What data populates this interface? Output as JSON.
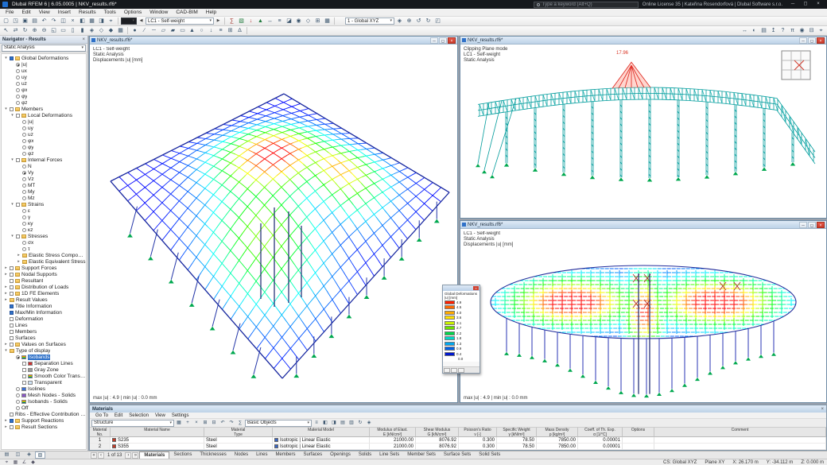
{
  "title_bar": {
    "app_title": "Dlubal RFEM 6 | 6.05.0005 | NKV_results.rf6*",
    "search_placeholder": "Type a keyword (Alt+Q)",
    "license_info": "Online License 35 | Kateřina Rosendorfová | Dlubal Software s.r.o.",
    "window_buttons": {
      "minimize": "─",
      "maximize": "◻",
      "close": "×"
    }
  },
  "menu_bar": {
    "items": [
      "File",
      "Edit",
      "View",
      "Insert",
      "Results",
      "Tools",
      "Options",
      "Window",
      "CAD-BIM",
      "Help"
    ]
  },
  "glyphs": {
    "caret": "▾",
    "prev": "◀",
    "next": "▶"
  },
  "toolbar1": {
    "group_a": [
      {
        "n": "new-model-icon",
        "g": "▢"
      },
      {
        "n": "open-model-icon",
        "g": "◳"
      },
      {
        "n": "save-icon",
        "g": "▣"
      },
      {
        "n": "print-icon",
        "g": "▤"
      },
      {
        "n": "undo-icon",
        "g": "↶"
      },
      {
        "n": "redo-icon",
        "g": "↷"
      },
      {
        "n": "copy-icon",
        "g": "◫"
      },
      {
        "n": "delete-icon",
        "g": "×"
      },
      {
        "n": "navigator-toggle-icon",
        "g": "◧"
      },
      {
        "n": "tables-toggle-icon",
        "g": "▦"
      },
      {
        "n": "panel-toggle-icon",
        "g": "◨"
      },
      {
        "n": "snap-settings-icon",
        "g": "⌖"
      }
    ],
    "render_combo_glyph": "▾",
    "load_case": "LC1 - Self-weight",
    "group_b": [
      {
        "n": "calculate-icon",
        "g": "∑",
        "c": "#a03028"
      },
      {
        "n": "show-results-icon",
        "g": "▧",
        "c": "#1f7a3c"
      },
      {
        "n": "show-loads-icon",
        "g": "↓",
        "c": "#b03030"
      },
      {
        "n": "show-supports-icon",
        "g": "▲",
        "c": "#1f7a3c"
      },
      {
        "n": "show-dimensions-icon",
        "g": "↔"
      },
      {
        "n": "show-numbering-icon",
        "g": "≡"
      },
      {
        "n": "clipping-plane-icon",
        "g": "◪"
      },
      {
        "n": "visibility-icon",
        "g": "◉"
      },
      {
        "n": "selection-mode-icon",
        "g": "◇"
      },
      {
        "n": "generate-mesh-icon",
        "g": "⊞"
      },
      {
        "n": "fe-mesh-icon",
        "g": "▦"
      }
    ],
    "cs_combo": "1 - Global XYZ",
    "group_c": [
      {
        "n": "isometric-view-icon",
        "g": "◈"
      },
      {
        "n": "zoom-all-icon",
        "g": "⊕"
      },
      {
        "n": "previous-view-icon",
        "g": "↺"
      },
      {
        "n": "next-view-icon",
        "g": "↻"
      },
      {
        "n": "full-screen-icon",
        "g": "◰"
      }
    ]
  },
  "toolbar2": {
    "group_a": [
      {
        "n": "select-icon",
        "g": "↖"
      },
      {
        "n": "pan-icon",
        "g": "⇄"
      },
      {
        "n": "orbit-icon",
        "g": "↻"
      },
      {
        "n": "zoom-in-icon",
        "g": "⊕"
      },
      {
        "n": "zoom-out-icon",
        "g": "⊖"
      },
      {
        "n": "zoom-window-icon",
        "g": "◱"
      },
      {
        "n": "view-x-icon",
        "g": "▭"
      },
      {
        "n": "view-y-icon",
        "g": "▯"
      },
      {
        "n": "view-z-icon",
        "g": "▮"
      },
      {
        "n": "view-iso-icon",
        "g": "◈"
      },
      {
        "n": "wireframe-icon",
        "g": "◇"
      },
      {
        "n": "solid-display-icon",
        "g": "◆"
      },
      {
        "n": "mesh-display-icon",
        "g": "▦"
      }
    ],
    "group_b": [
      {
        "n": "new-node-icon",
        "g": "●"
      },
      {
        "n": "new-line-icon",
        "g": "∕"
      },
      {
        "n": "new-member-icon",
        "g": "─"
      },
      {
        "n": "new-surface-icon",
        "g": "▱"
      },
      {
        "n": "new-solid-icon",
        "g": "▰"
      },
      {
        "n": "new-opening-icon",
        "g": "▭"
      },
      {
        "n": "new-support-icon",
        "g": "▲"
      },
      {
        "n": "new-hinge-icon",
        "g": "○"
      },
      {
        "n": "new-load-icon",
        "g": "↓"
      },
      {
        "n": "load-cases-icon",
        "g": "≡"
      },
      {
        "n": "combinations-icon",
        "g": "⊞"
      },
      {
        "n": "imperfection-icon",
        "g": "∆"
      }
    ],
    "group_c": [
      {
        "n": "dimension-icon",
        "g": "↔"
      },
      {
        "n": "render-mode-icon",
        "g": "◐"
      },
      {
        "n": "print-graphic-icon",
        "g": "▤"
      },
      {
        "n": "export-icon",
        "g": "↥"
      },
      {
        "n": "help-icon",
        "g": "?"
      },
      {
        "n": "units-icon",
        "g": "π"
      },
      {
        "n": "info-icon",
        "g": "◉"
      },
      {
        "n": "collapse-icon",
        "g": "⊟"
      },
      {
        "n": "measure-icon",
        "g": "⌖"
      }
    ]
  },
  "navigator": {
    "title": "Navigator - Results",
    "close_glyph": "×",
    "analysis_combo": "Static Analysis",
    "tree": [
      {
        "l": "Global Deformations",
        "v": 0,
        "e": 1,
        "c": 1,
        "f": 1
      },
      {
        "l": "|u|",
        "v": 1,
        "r": 1
      },
      {
        "l": "ux",
        "v": 1,
        "r": 0
      },
      {
        "l": "uy",
        "v": 1,
        "r": 0
      },
      {
        "l": "uz",
        "v": 1,
        "r": 0
      },
      {
        "l": "φx",
        "v": 1,
        "r": 0
      },
      {
        "l": "φy",
        "v": 1,
        "r": 0
      },
      {
        "l": "φz",
        "v": 1,
        "r": 0
      },
      {
        "l": "Members",
        "v": 0,
        "e": 1,
        "c": 0,
        "f": 1
      },
      {
        "l": "Local Deformations",
        "v": 1,
        "e": 1,
        "c": 0,
        "f": 1
      },
      {
        "l": "|u|",
        "v": 2,
        "r": 0
      },
      {
        "l": "uy",
        "v": 2,
        "r": 0
      },
      {
        "l": "uz",
        "v": 2,
        "r": 0
      },
      {
        "l": "φx",
        "v": 2,
        "r": 0
      },
      {
        "l": "φy",
        "v": 2,
        "r": 0
      },
      {
        "l": "φz",
        "v": 2,
        "r": 0
      },
      {
        "l": "Internal Forces",
        "v": 1,
        "e": 1,
        "c": 0,
        "f": 1
      },
      {
        "l": "N",
        "v": 2,
        "r": 0
      },
      {
        "l": "Vy",
        "v": 2,
        "r": 1
      },
      {
        "l": "Vz",
        "v": 2,
        "r": 0
      },
      {
        "l": "MT",
        "v": 2,
        "r": 0
      },
      {
        "l": "My",
        "v": 2,
        "r": 0
      },
      {
        "l": "Mz",
        "v": 2,
        "r": 0
      },
      {
        "l": "Strains",
        "v": 1,
        "e": 1,
        "c": 0,
        "f": 1
      },
      {
        "l": "ε",
        "v": 2,
        "r": 0
      },
      {
        "l": "γ",
        "v": 2,
        "r": 0
      },
      {
        "l": "κy",
        "v": 2,
        "r": 0
      },
      {
        "l": "κz",
        "v": 2,
        "r": 0
      },
      {
        "l": "Stresses",
        "v": 1,
        "e": 1,
        "c": 0,
        "f": 1
      },
      {
        "l": "σx",
        "v": 2,
        "r": 0
      },
      {
        "l": "τ",
        "v": 2,
        "r": 0
      },
      {
        "l": "Elastic Stress Components",
        "v": 2,
        "e": 2,
        "f": 1
      },
      {
        "l": "Elastic Equivalent Stress",
        "v": 2,
        "e": 2,
        "f": 1
      },
      {
        "l": "Support Forces",
        "v": 0,
        "e": 2,
        "c": 0,
        "f": 1
      },
      {
        "l": "Nodal Supports",
        "v": 0,
        "e": 2,
        "c": 0,
        "f": 1
      },
      {
        "l": "Resultant",
        "v": 0,
        "c": 0,
        "f": 1
      },
      {
        "l": "Distribution of Loads",
        "v": 0,
        "e": 2,
        "c": 0,
        "f": 1
      },
      {
        "l": "1D FE Elements",
        "v": 0,
        "e": 2,
        "c": 0,
        "f": 1
      },
      {
        "l": "Result Values",
        "v": 0,
        "e": 2,
        "f": 1
      },
      {
        "l": "Title Information",
        "v": 0,
        "c": 1
      },
      {
        "l": "Max/Min Information",
        "v": 0,
        "c": 1
      },
      {
        "l": "Deformation",
        "v": 0,
        "c": 0
      },
      {
        "l": "Lines",
        "v": 0,
        "c": 0
      },
      {
        "l": "Members",
        "v": 0,
        "c": 0
      },
      {
        "l": "Surfaces",
        "v": 0,
        "c": 0
      },
      {
        "l": "Values on Surfaces",
        "v": 0,
        "e": 2,
        "c": 0,
        "f": 1
      },
      {
        "l": "Type of display",
        "v": 0,
        "e": 1,
        "f": 1
      },
      {
        "l": "Isobands",
        "v": 1,
        "r": 1,
        "k": "rainbow",
        "h": 1
      },
      {
        "l": "Separation Lines",
        "v": 2,
        "c": 0,
        "k": "#cc3333"
      },
      {
        "l": "Gray Zone",
        "v": 2,
        "c": 0,
        "k": "#9a9a9a"
      },
      {
        "l": "Smooth Color Transition",
        "v": 2,
        "c": 0,
        "k": "rainbow"
      },
      {
        "l": "Transparent",
        "v": 2,
        "c": 0,
        "k": "#cfe3f5"
      },
      {
        "l": "Isolines",
        "v": 1,
        "r": 0,
        "k": "#3b6fd4"
      },
      {
        "l": "Mesh Nodes - Solids",
        "v": 1,
        "r": 0,
        "k": "#8a55c8"
      },
      {
        "l": "Isobands - Solids",
        "v": 1,
        "r": 0,
        "k": "rainbow"
      },
      {
        "l": "Off",
        "v": 1,
        "r": 0
      },
      {
        "l": "Ribs - Effective Contribution on Surfac...",
        "v": 0,
        "c": 0
      },
      {
        "l": "Support Reactions",
        "v": 0,
        "e": 2,
        "c": 1,
        "f": 1
      },
      {
        "l": "Result Sections",
        "v": 0,
        "e": 2,
        "c": 0,
        "f": 1
      }
    ],
    "bottom_tabs": [
      {
        "n": "data-navigator-tab-icon",
        "g": "▤"
      },
      {
        "n": "display-navigator-tab-icon",
        "g": "◫"
      },
      {
        "n": "views-navigator-tab-icon",
        "g": "◈"
      },
      {
        "n": "results-navigator-tab-icon",
        "g": "▧",
        "active": true
      }
    ]
  },
  "viewports": {
    "main": {
      "title": "NKV_results.rf6*",
      "info": [
        "LC1 - Self-weight",
        "Static Analysis",
        "Displacements |u| [mm]"
      ],
      "result_summary": "max |u| : 4.9 | min |u| : 0.0 mm"
    },
    "top_right": {
      "title": "NKV_results.rf6*",
      "info": [
        "Clipping Plane mode",
        "LC1 - Self-weight",
        "Static Analysis"
      ],
      "peak_value": "17.96"
    },
    "bottom_right": {
      "title": "NKV_results.rf6*",
      "info": [
        "LC1 - Self-weight",
        "Static Analysis",
        "Displacements |u| [mm]"
      ],
      "result_summary": "max |u| : 4.9 | min |u| : 0.0 mm"
    }
  },
  "legend": {
    "title": "Global Deformations",
    "subtitle": "|u| [mm]",
    "bands": [
      {
        "color": "#ff2000",
        "value": "4.9"
      },
      {
        "color": "#ff6a00",
        "value": "4.5"
      },
      {
        "color": "#ffaa00",
        "value": "4.0"
      },
      {
        "color": "#ffe000",
        "value": "3.6"
      },
      {
        "color": "#c8f000",
        "value": "3.1"
      },
      {
        "color": "#6ee000",
        "value": "2.7"
      },
      {
        "color": "#00d84a",
        "value": "2.2"
      },
      {
        "color": "#00d8c8",
        "value": "1.8"
      },
      {
        "color": "#00a8f0",
        "value": "1.3"
      },
      {
        "color": "#0060e8",
        "value": "0.9"
      },
      {
        "color": "#0018d0",
        "value": "0.4"
      }
    ],
    "min_value": "0.0"
  },
  "materials_panel": {
    "title": "Materials",
    "close_glyph": "×",
    "menu": [
      "Go To",
      "Edit",
      "Selection",
      "View",
      "Settings"
    ],
    "combo_structure": "Structure",
    "combo_objects": "Basic Objects",
    "toolbar_icons": [
      {
        "n": "table-icon",
        "g": "▦"
      },
      {
        "n": "add-row-icon",
        "g": "+"
      },
      {
        "n": "delete-row-icon",
        "g": "×"
      },
      {
        "n": "expand-icon",
        "g": "⊞"
      },
      {
        "n": "collapse-icon",
        "g": "⊟"
      },
      {
        "n": "undo-icon",
        "g": "↶"
      },
      {
        "n": "redo-icon",
        "g": "↷"
      },
      {
        "n": "sum-icon",
        "g": "∑"
      },
      {
        "n": "filter-icon",
        "g": "≡"
      },
      {
        "n": "columns-left-icon",
        "g": "◧"
      },
      {
        "n": "columns-right-icon",
        "g": "◨"
      },
      {
        "n": "export-table-icon",
        "g": "▤"
      },
      {
        "n": "import-table-icon",
        "g": "▥"
      },
      {
        "n": "refresh-icon",
        "g": "↻"
      },
      {
        "n": "view-3d-icon",
        "g": "◈"
      }
    ],
    "columns": [
      {
        "t": "Material",
        "s": "No."
      },
      {
        "t": "Material Name",
        "s": " "
      },
      {
        "t": "Material",
        "s": "Type"
      },
      {
        "t": "Material Model",
        "s": " "
      },
      {
        "t": "Modulus of Elast.",
        "s": "E [kN/cm²]"
      },
      {
        "t": "Shear Modulus",
        "s": "G [kN/cm²]"
      },
      {
        "t": "Poisson's Ratio",
        "s": "ν [-]"
      },
      {
        "t": "Specific Weight",
        "s": "γ [kN/m³]"
      },
      {
        "t": "Mass Density",
        "s": "ρ [kg/m³]"
      },
      {
        "t": "Coeff. of Th. Exp.",
        "s": "α [1/°C]"
      },
      {
        "t": "Options",
        "s": " "
      },
      {
        "t": "Comment",
        "s": " "
      }
    ],
    "rows": [
      {
        "no": "1",
        "name": "S235",
        "name_chip": "#c43a27",
        "type": "Steel",
        "model": "Isotropic | Linear Elastic",
        "model_chip": "#3a66c4",
        "e": "21000.00",
        "g_mod": "8076.92",
        "nu": "0.300",
        "gamma": "78.50",
        "rho": "7850.00",
        "alpha": "0.00001",
        "options": "",
        "comment": ""
      },
      {
        "no": "2",
        "name": "S355",
        "name_chip": "#c43a27",
        "type": "Steel",
        "model": "Isotropic | Linear Elastic",
        "model_chip": "#3a66c4",
        "e": "21000.00",
        "g_mod": "8076.92",
        "nu": "0.300",
        "gamma": "78.50",
        "rho": "7850.00",
        "alpha": "0.00001",
        "options": "",
        "comment": ""
      }
    ]
  },
  "bottom_tabs": {
    "pager": {
      "first": "«",
      "prev": "‹",
      "label": "1 of 13",
      "next": "›",
      "last": "»"
    },
    "tabs": [
      "Materials",
      "Sections",
      "Thicknesses",
      "Nodes",
      "Lines",
      "Members",
      "Surfaces",
      "Openings",
      "Solids",
      "Line Sets",
      "Member Sets",
      "Surface Sets",
      "Solid Sets"
    ],
    "active": "Materials"
  },
  "status_bar": {
    "icons": [
      {
        "n": "snap-status-icon",
        "g": "⌖"
      },
      {
        "n": "grid-status-icon",
        "g": "▦"
      },
      {
        "n": "ortho-status-icon",
        "g": "∠"
      },
      {
        "n": "osnap-status-icon",
        "g": "◆"
      }
    ],
    "cs_label": "CS: Global XYZ",
    "plane_label": "Plane XY",
    "x": "X: 26.170 m",
    "y": "Y: -34.112 m",
    "z": "Z: 0.000 m"
  }
}
